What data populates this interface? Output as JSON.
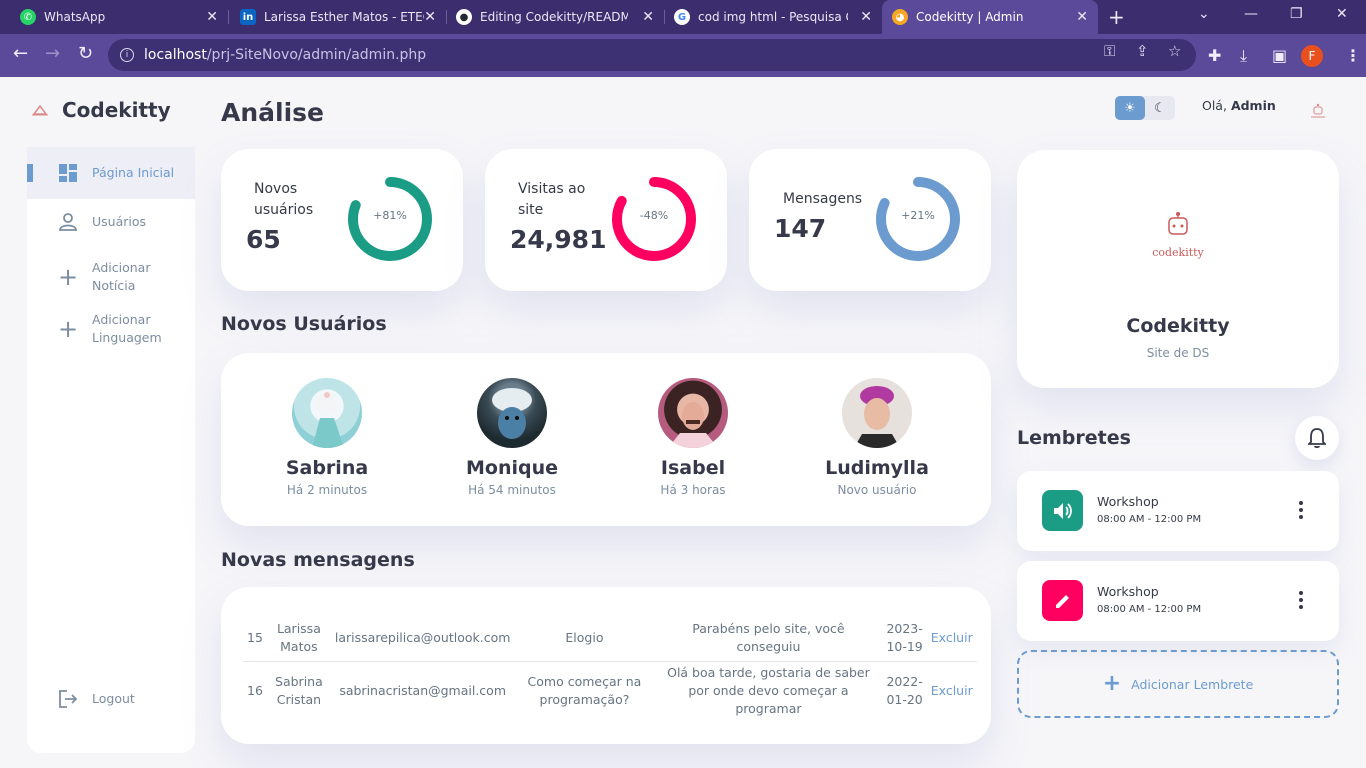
{
  "browser": {
    "tabs": [
      {
        "title": "WhatsApp",
        "icon": "whatsapp-icon",
        "color": "#25d366"
      },
      {
        "title": "Larissa Esther Matos - ETEC de",
        "icon": "linkedin-icon",
        "color": "#0a66c2"
      },
      {
        "title": "Editing Codekitty/README.md",
        "icon": "github-icon",
        "color": "#24292e"
      },
      {
        "title": "cod img html - Pesquisa Google",
        "icon": "google-icon",
        "color": "#ffffff"
      },
      {
        "title": "Codekitty | Admin",
        "icon": "cat-icon",
        "color": "#f5a623"
      }
    ],
    "url_host": "localhost",
    "url_path": "/prj-SiteNovo/admin/admin.php",
    "profile_initial": "F"
  },
  "brand": {
    "name": "Codekitty"
  },
  "sidebar": {
    "items": [
      {
        "label": "Página Inicial",
        "icon": "dashboard-icon"
      },
      {
        "label": "Usuários",
        "icon": "user-icon"
      },
      {
        "label": "Adicionar Notícia",
        "icon": "plus-icon"
      },
      {
        "label": "Adicionar Linguagem",
        "icon": "plus-icon"
      },
      {
        "label": "Logout",
        "icon": "logout-icon"
      }
    ]
  },
  "header": {
    "title": "Análise",
    "greeting": "Olá,",
    "user": "Admin"
  },
  "stats": [
    {
      "label": "Novos usuários",
      "value": "65",
      "percent": "+81%",
      "progress": 0.81,
      "color": "#1b9c85"
    },
    {
      "label": "Visitas ao site",
      "value": "24,981",
      "percent": "-48%",
      "progress": 0.83,
      "color": "#ff0060"
    },
    {
      "label": "Mensagens",
      "value": "147",
      "percent": "+21%",
      "progress": 0.82,
      "color": "#6c9bcf"
    }
  ],
  "new_users": {
    "title": "Novos Usuários",
    "users": [
      {
        "name": "Sabrina",
        "time": "Há 2 minutos"
      },
      {
        "name": "Monique",
        "time": "Há 54 minutos"
      },
      {
        "name": "Isabel",
        "time": "Há 3 horas"
      },
      {
        "name": "Ludimylla",
        "time": "Novo usuário"
      }
    ]
  },
  "messages": {
    "title": "Novas mensagens",
    "rows": [
      {
        "id": "15",
        "name": "Larissa Matos",
        "email": "larissarepilica@outlook.com",
        "subject": "Elogio",
        "message": "Parabéns pelo site, você conseguiu",
        "date": "2023-10-19",
        "action": "Excluir"
      },
      {
        "id": "16",
        "name": "Sabrina Cristan",
        "email": "sabrinacristan@gmail.com",
        "subject": "Como começar na programação?",
        "message": "Olá boa tarde, gostaria de saber por onde devo começar a programar",
        "date": "2022-01-20",
        "action": "Excluir"
      }
    ]
  },
  "profile_card": {
    "logo_text": "codekitty",
    "name": "Codekitty",
    "subtitle": "Site de DS"
  },
  "reminders": {
    "title": "Lembretes",
    "items": [
      {
        "title": "Workshop",
        "time": "08:00 AM - 12:00 PM",
        "icon": "volume-icon",
        "color": "#1b9c85"
      },
      {
        "title": "Workshop",
        "time": "08:00 AM - 12:00 PM",
        "icon": "edit-icon",
        "color": "#ff0060"
      }
    ],
    "add_label": "Adicionar Lembrete"
  }
}
